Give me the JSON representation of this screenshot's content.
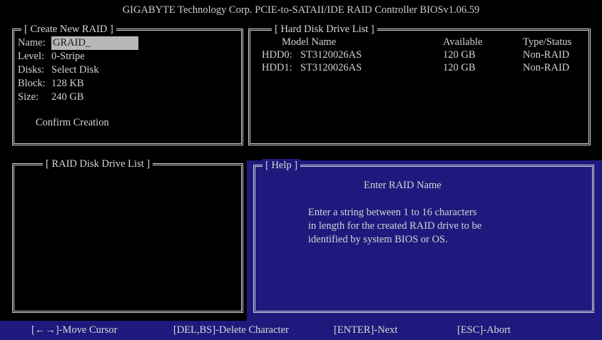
{
  "window": {
    "title": "GIGABYTE Technology Corp. PCIE-to-SATAII/IDE RAID Controller BIOSv1.06.59"
  },
  "create_raid": {
    "panel_title": "[ Create New RAID ]",
    "fields": [
      {
        "label": "Name:",
        "value": "GRAID_"
      },
      {
        "label": "Level:",
        "value": "0-Stripe"
      },
      {
        "label": "Disks:",
        "value": "Select Disk"
      },
      {
        "label": "Block:",
        "value": "128 KB"
      },
      {
        "label": "Size:",
        "value": "240 GB"
      }
    ],
    "confirm_label": "Confirm Creation"
  },
  "hdd_list": {
    "panel_title": "[ Hard Disk Drive List ]",
    "headers": [
      "Model Name",
      "Available",
      "Type/Status"
    ],
    "rows": [
      {
        "id": "HDD0:",
        "model": "ST3120026AS",
        "available": "120 GB",
        "status": "Non-RAID"
      },
      {
        "id": "HDD1:",
        "model": "ST3120026AS",
        "available": "120 GB",
        "status": "Non-RAID"
      }
    ]
  },
  "raid_list": {
    "panel_title": "[ RAID Disk Drive List ]"
  },
  "help": {
    "panel_title": "[ Help ]",
    "heading": "Enter RAID Name",
    "lines": [
      "Enter a string between 1 to 16 characters",
      "in length for the created RAID drive to be",
      "identified by system BIOS or OS."
    ]
  },
  "statusbar": {
    "items": [
      "[←→]-Move Cursor",
      "[DEL,BS]-Delete Character",
      "[ENTER]-Next",
      "[ESC]-Abort"
    ]
  },
  "colors": {
    "background": "#000000",
    "highlight_blue": "#1e1a7d",
    "text": "#d4d4d4",
    "selection": "#b8b8b8"
  }
}
